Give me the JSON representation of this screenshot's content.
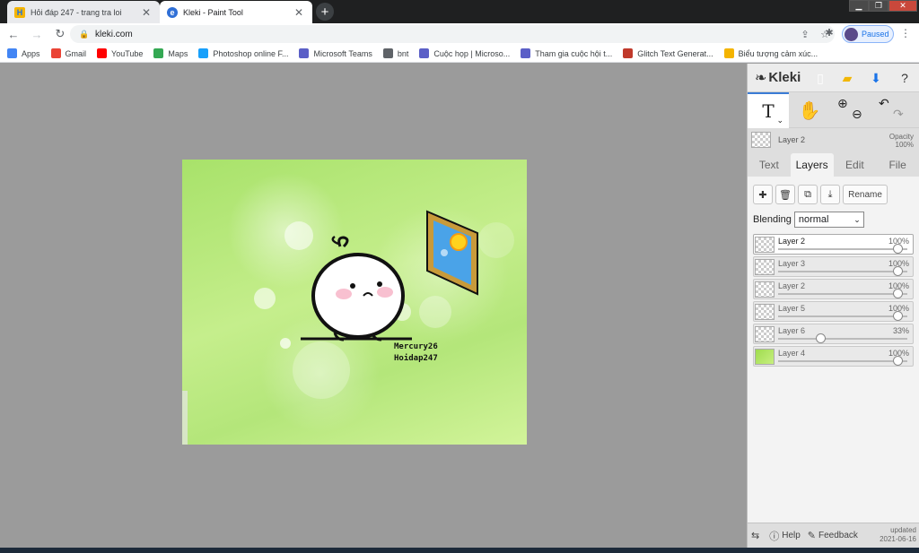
{
  "browser": {
    "tabs": [
      {
        "title": "Hỏi đáp 247 - trang tra loi",
        "active": false
      },
      {
        "title": "Kleki - Paint Tool",
        "active": true
      }
    ],
    "url": "kleki.com",
    "profile_label": "Paused"
  },
  "bookmarks": [
    {
      "label": "Apps",
      "icon": "apps-grid-icon",
      "color": "#4285f4"
    },
    {
      "label": "Gmail",
      "icon": "gmail-icon",
      "color": "#ea4335"
    },
    {
      "label": "YouTube",
      "icon": "youtube-icon",
      "color": "#ff0000"
    },
    {
      "label": "Maps",
      "icon": "maps-icon",
      "color": "#34a853"
    },
    {
      "label": "Photoshop online F...",
      "icon": "photopea-icon",
      "color": "#18a0fb"
    },
    {
      "label": "Microsoft Teams",
      "icon": "teams-icon",
      "color": "#5b5fc7"
    },
    {
      "label": "bnt",
      "icon": "globe-icon",
      "color": "#5f6368"
    },
    {
      "label": "Cuộc họp | Microso...",
      "icon": "teams-icon",
      "color": "#5b5fc7"
    },
    {
      "label": "Tham gia cuộc hội t...",
      "icon": "teams-icon",
      "color": "#5b5fc7"
    },
    {
      "label": "Glitch Text Generat...",
      "icon": "glitch-icon",
      "color": "#c0392b"
    },
    {
      "label": "Biểu tượng cảm xúc...",
      "icon": "emoji-icon",
      "color": "#f4b400"
    }
  ],
  "canvas": {
    "signature_line1": "Mercury26",
    "signature_line2": "Hoidap247"
  },
  "panel": {
    "app_name": "Kleki",
    "current_layer": "Layer 2",
    "opacity_label": "Opacity",
    "opacity_value": "100%",
    "tabs": [
      {
        "label": "Text",
        "active": false
      },
      {
        "label": "Layers",
        "active": true
      },
      {
        "label": "Edit",
        "active": false
      },
      {
        "label": "File",
        "active": false
      }
    ],
    "rename_label": "Rename",
    "blending_label": "Blending",
    "blending_value": "normal",
    "layers": [
      {
        "name": "Layer 2",
        "opacity": "100%",
        "opacity_fraction": 1.0,
        "active": true
      },
      {
        "name": "Layer 3",
        "opacity": "100%",
        "opacity_fraction": 1.0,
        "active": false
      },
      {
        "name": "Layer 2",
        "opacity": "100%",
        "opacity_fraction": 1.0,
        "active": false
      },
      {
        "name": "Layer 5",
        "opacity": "100%",
        "opacity_fraction": 1.0,
        "active": false
      },
      {
        "name": "Layer 6",
        "opacity": "33%",
        "opacity_fraction": 0.33,
        "active": false
      },
      {
        "name": "Layer 4",
        "opacity": "100%",
        "opacity_fraction": 1.0,
        "active": false
      }
    ],
    "footer": {
      "help": "Help",
      "feedback": "Feedback",
      "updated_label": "updated",
      "updated_date": "2021-06-16"
    }
  },
  "colors": {
    "accent": "#3a7bd5",
    "canvas_green": "#b4e67a"
  }
}
